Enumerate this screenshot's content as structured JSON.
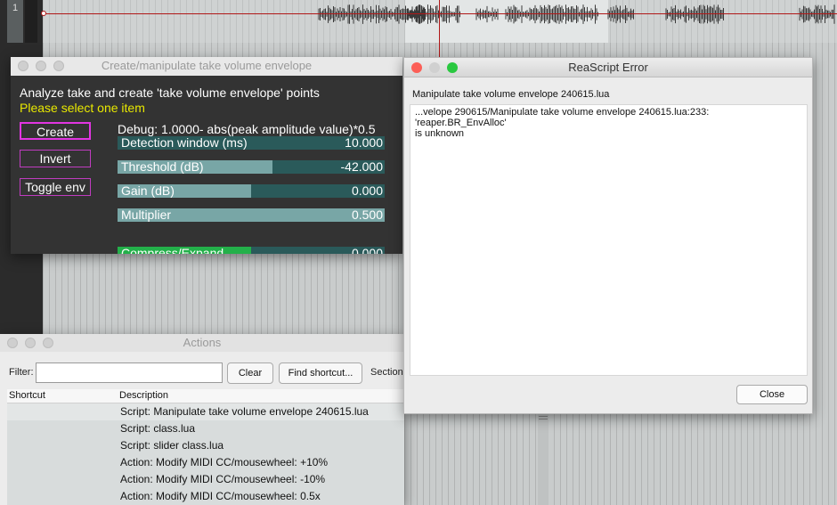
{
  "arrange": {
    "track_number": "1"
  },
  "script_window": {
    "title": "Create/manipulate take volume envelope",
    "heading": "Analyze take and create 'take volume envelope' points",
    "status": "Please select one item",
    "buttons": {
      "create": "Create",
      "invert": "Invert",
      "toggle": "Toggle env"
    },
    "debug": "Debug: 1.0000- abs(peak amplitude value)*0.5",
    "sliders": [
      {
        "label": "Detection window (ms)",
        "value": "10.000",
        "fill": 0.0
      },
      {
        "label": "Threshold (dB)",
        "value": "-42.000",
        "fill": 0.58
      },
      {
        "label": "Gain (dB)",
        "value": "0.000",
        "fill": 0.5
      },
      {
        "label": "Multiplier",
        "value": "0.500",
        "fill": 1.0
      },
      {
        "label": "Compress/Expand",
        "value": "0.000",
        "fill": 0.5
      }
    ],
    "colors": {
      "status": "#e8e800",
      "button_border": "#c03cc0",
      "compress_fill": "#23b04a"
    }
  },
  "actions_window": {
    "title": "Actions",
    "filter_label": "Filter:",
    "filter_value": "",
    "clear_button": "Clear",
    "find_button": "Find shortcut...",
    "section_label": "Section",
    "columns": {
      "shortcut": "Shortcut",
      "description": "Description"
    },
    "rows": [
      {
        "shortcut": "",
        "description": "Script: Manipulate take volume envelope 240615.lua",
        "selected": true
      },
      {
        "shortcut": "",
        "description": "Script: class.lua",
        "selected": false
      },
      {
        "shortcut": "",
        "description": "Script: slider class.lua",
        "selected": false
      },
      {
        "shortcut": "",
        "description": "Action: Modify MIDI CC/mousewheel: +10%",
        "selected": false
      },
      {
        "shortcut": "",
        "description": "Action: Modify MIDI CC/mousewheel: -10%",
        "selected": false
      },
      {
        "shortcut": "",
        "description": "Action: Modify MIDI CC/mousewheel: 0.5x",
        "selected": false
      }
    ]
  },
  "error_dialog": {
    "title": "ReaScript Error",
    "script_name": "Manipulate take volume envelope 240615.lua",
    "message_line1": "...velope 290615/Manipulate take volume envelope 240615.lua:233: 'reaper.BR_EnvAlloc'",
    "message_line2": "is unknown",
    "close_button": "Close",
    "traffic_colors": {
      "close": "#fc5f57",
      "minimize": "#d0d0d0",
      "zoom": "#2ac840"
    }
  }
}
